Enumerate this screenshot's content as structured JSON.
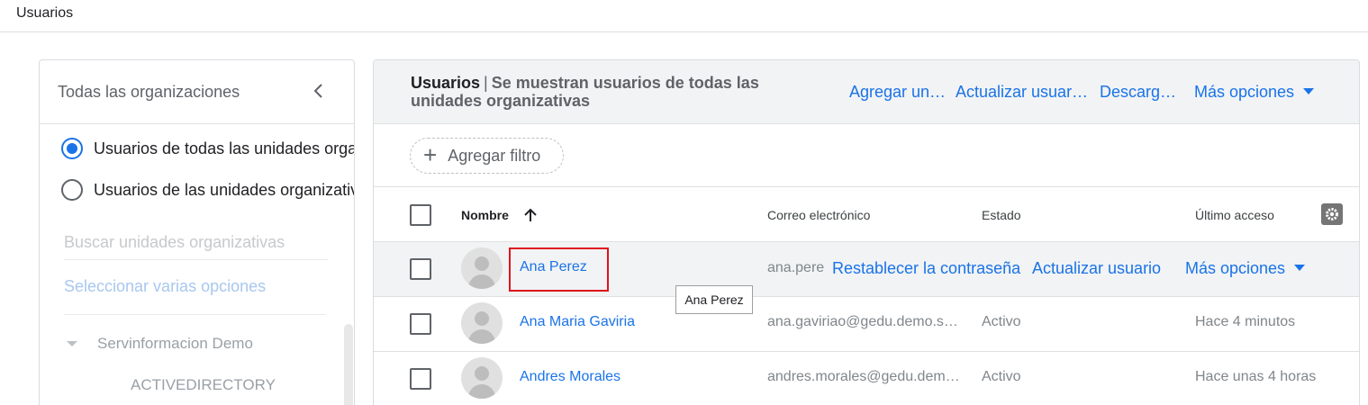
{
  "page": {
    "title": "Usuarios"
  },
  "sidebar": {
    "title": "Todas las organizaciones",
    "radio_options": [
      {
        "label": "Usuarios de todas las unidades orga",
        "selected": true
      },
      {
        "label": "Usuarios de las unidades organizativ",
        "selected": false
      }
    ],
    "search_placeholder": "Buscar unidades organizativas",
    "multi_select_label": "Seleccionar varias opciones",
    "tree": {
      "root": "Servinformacion Demo",
      "children": [
        "ACTIVEDIRECTORY"
      ]
    }
  },
  "main": {
    "title_strong": "Usuarios",
    "title_separator": "|",
    "title_rest": "Se muestran usuarios de todas las unidades organizativas",
    "actions": [
      {
        "label": "Agregar un…"
      },
      {
        "label": "Actualizar usuar…"
      },
      {
        "label": "Descarg…"
      },
      {
        "label": "Más opciones"
      }
    ],
    "filter_label": "Agregar filtro",
    "columns": {
      "name": "Nombre",
      "email": "Correo electrónico",
      "status": "Estado",
      "last_access": "Último acceso"
    },
    "rows": [
      {
        "name": "Ana Perez",
        "email": "ana.pere",
        "hover_actions": [
          "Restablecer la contraseña",
          "Actualizar usuario",
          "Más opciones"
        ]
      },
      {
        "name": "Ana Maria Gaviria",
        "email": "ana.gaviriao@gedu.demo.s…",
        "status": "Activo",
        "last_access": "Hace 4 minutos"
      },
      {
        "name": "Andres Morales",
        "email": "andres.morales@gedu.dem…",
        "status": "Activo",
        "last_access": "Hace unas 4 horas"
      }
    ],
    "tooltip": "Ana Perez"
  },
  "colors": {
    "link": "#1a73e8",
    "highlight_border": "#e0141e",
    "header_bg": "#f1f3f4"
  }
}
